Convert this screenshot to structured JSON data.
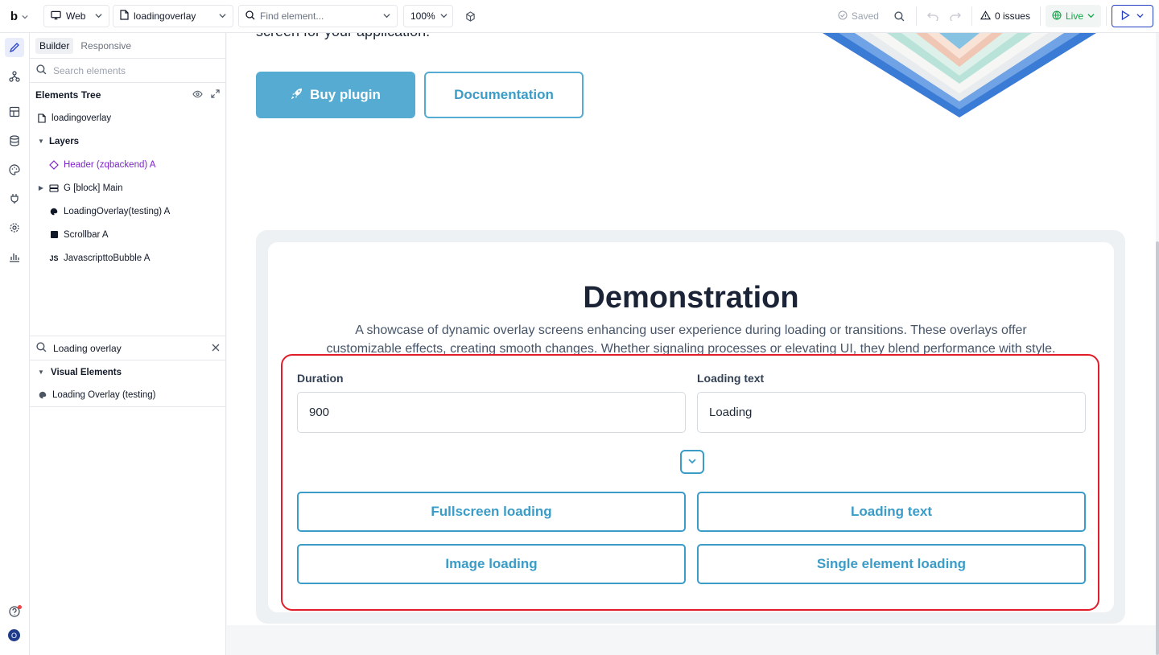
{
  "topbar": {
    "logo": "b",
    "platform": "Web",
    "page": "loadingoverlay",
    "find_placeholder": "Find element...",
    "zoom": "100%",
    "saved": "Saved",
    "issues": "0 issues",
    "live": "Live"
  },
  "sidebar_tabs": {
    "builder": "Builder",
    "responsive": "Responsive"
  },
  "elements_search_placeholder": "Search elements",
  "tree": {
    "title": "Elements Tree",
    "page_item": "loadingoverlay",
    "layers": "Layers",
    "items": [
      "Header (zqbackend) A",
      "G [block] Main",
      "LoadingOverlay(testing) A",
      "Scrollbar A",
      "JavascripttoBubble A"
    ],
    "js_badge": "JS"
  },
  "plugin_search": {
    "value": "Loading overlay",
    "section": "Visual Elements",
    "result": "Loading Overlay (testing)"
  },
  "canvas": {
    "hero_text": "screen for your application.",
    "buy_label": "Buy plugin",
    "doc_label": "Documentation",
    "demo_title": "Demonstration",
    "demo_desc": "A showcase of dynamic overlay screens enhancing user experience during loading or transitions. These overlays offer customizable effects, creating smooth changes. Whether signaling processes or elevating UI, they blend performance with style.",
    "duration_label": "Duration",
    "duration_value": "900",
    "loading_text_label": "Loading text",
    "loading_text_value": "Loading",
    "buttons": [
      "Fullscreen loading",
      "Loading text",
      "Image loading",
      "Single element loading"
    ]
  },
  "user_initial": "O",
  "colors": {
    "accent": "#55abd1",
    "accent_text": "#3a9cc7",
    "highlight": "#e11d2a",
    "brand_blue": "#2540c7",
    "live_green": "#16a34a"
  }
}
